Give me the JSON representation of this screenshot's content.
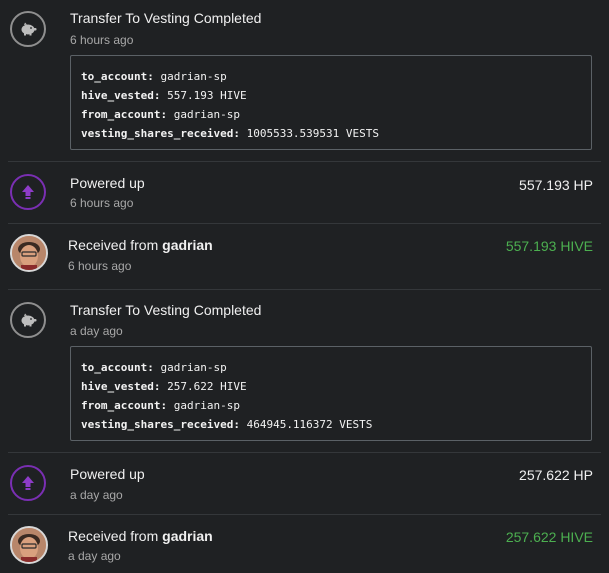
{
  "colors": {
    "background": "#1f2123",
    "green_amount": "#4caf50",
    "powerup_purple": "#7a2fb3",
    "gray_icon": "#8f8f8f"
  },
  "feed": [
    {
      "type": "transfer_to_vesting_completed",
      "icon": "piggy-bank-icon",
      "title": "Transfer To Vesting Completed",
      "time": "6 hours ago",
      "details": [
        {
          "key": "to_account:",
          "value": "gadrian-sp"
        },
        {
          "key": "hive_vested:",
          "value": "557.193 HIVE"
        },
        {
          "key": "from_account:",
          "value": "gadrian-sp"
        },
        {
          "key": "vesting_shares_received:",
          "value": "1005533.539531 VESTS"
        }
      ]
    },
    {
      "type": "powered_up",
      "icon": "arrow-up-icon",
      "title": "Powered up",
      "time": "6 hours ago",
      "amount": "557.193 HP"
    },
    {
      "type": "received",
      "icon": "avatar",
      "title_prefix": "Received from",
      "title_user": "gadrian",
      "time": "6 hours ago",
      "amount": "557.193 HIVE"
    },
    {
      "type": "transfer_to_vesting_completed",
      "icon": "piggy-bank-icon",
      "title": "Transfer To Vesting Completed",
      "time": "a day ago",
      "details": [
        {
          "key": "to_account:",
          "value": "gadrian-sp"
        },
        {
          "key": "hive_vested:",
          "value": "257.622 HIVE"
        },
        {
          "key": "from_account:",
          "value": "gadrian-sp"
        },
        {
          "key": "vesting_shares_received:",
          "value": "464945.116372 VESTS"
        }
      ]
    },
    {
      "type": "powered_up",
      "icon": "arrow-up-icon",
      "title": "Powered up",
      "time": "a day ago",
      "amount": "257.622 HP"
    },
    {
      "type": "received",
      "icon": "avatar",
      "title_prefix": "Received from",
      "title_user": "gadrian",
      "time": "a day ago",
      "amount": "257.622 HIVE"
    }
  ]
}
